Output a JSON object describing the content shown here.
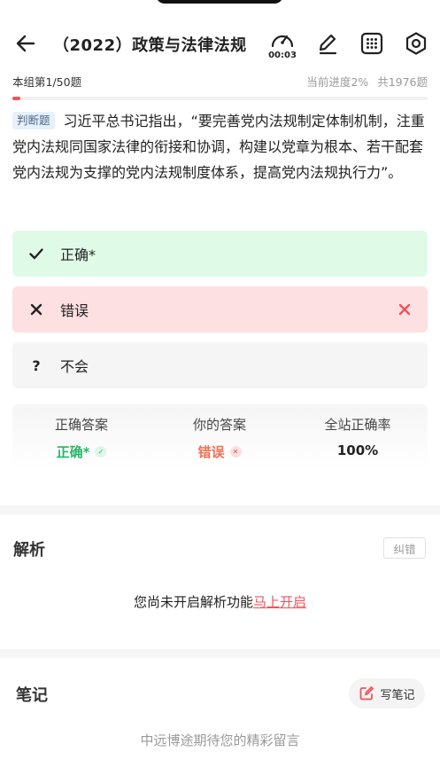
{
  "header": {
    "title": "（2022）政策与法律法规",
    "timer": "00:03"
  },
  "progress": {
    "group_label": "本组第1/50题",
    "current_progress": "当前进度2%",
    "total": "共1976题",
    "fraction": 0.02
  },
  "question": {
    "type_tag": "判断题",
    "text": "习近平总书记指出，“要完善党内法规制定体制机制，注重党内法规同国家法律的衔接和协调，构建以党章为根本、若干配套党内法规为支撑的党内法规制度体系，提高党内法规执行力”。"
  },
  "options": [
    {
      "label": "正确*",
      "icon": "check-icon",
      "state": "correct"
    },
    {
      "label": "错误",
      "icon": "x-icon",
      "state": "wrong"
    },
    {
      "label": "不会",
      "icon": "question-icon",
      "state": "neutral"
    }
  ],
  "answers": {
    "correct_header": "正确答案",
    "yours_header": "你的答案",
    "rate_header": "全站正确率",
    "correct_value": "正确*",
    "yours_value": "错误",
    "rate_value": "100%"
  },
  "analysis": {
    "title": "解析",
    "report_button": "纠错",
    "message": "您尚未开启解析功能",
    "link": "马上开启"
  },
  "notes": {
    "title": "笔记",
    "write_button": "写笔记",
    "empty_message": "中远博途期待您的精彩留言"
  },
  "colors": {
    "accent": "#f0535b",
    "correct_bg": "#dffbe8",
    "wrong_bg": "#fde0e1",
    "correct_text": "#2ab66a",
    "wrong_text": "#f07055"
  }
}
